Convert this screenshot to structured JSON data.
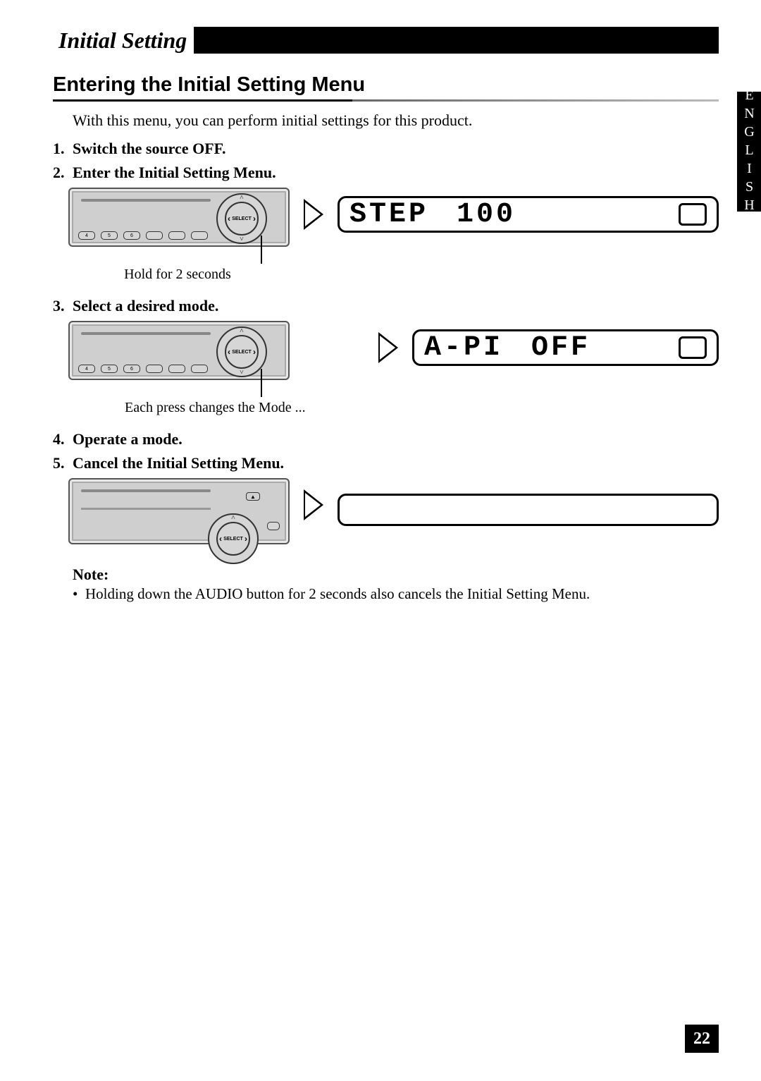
{
  "header": {
    "title": "Initial Setting"
  },
  "sideTab": "ENGLISH",
  "section": {
    "title": "Entering the Initial Setting Menu",
    "intro": "With this menu, you can perform initial settings for this product."
  },
  "steps": {
    "s1": {
      "num": "1.",
      "text": "Switch the source OFF."
    },
    "s2": {
      "num": "2.",
      "text": "Enter the Initial Setting Menu."
    },
    "s3": {
      "num": "3.",
      "text": "Select a desired mode."
    },
    "s4": {
      "num": "4.",
      "text": "Operate a mode."
    },
    "s5": {
      "num": "5.",
      "text": "Cancel the Initial Setting Menu."
    }
  },
  "callouts": {
    "hold": "Hold for 2 seconds",
    "press": "Each press changes the Mode ..."
  },
  "lcd": {
    "line1a": "STEP",
    "line1b": "100",
    "line2a": "A-PI",
    "line2b": "OFF"
  },
  "device": {
    "selectLabel": "SELECT",
    "presets": [
      "4",
      "5",
      "6"
    ]
  },
  "note": {
    "label": "Note:",
    "text": "Holding down the AUDIO button for 2 seconds also cancels the Initial Setting Menu."
  },
  "pageNumber": "22"
}
